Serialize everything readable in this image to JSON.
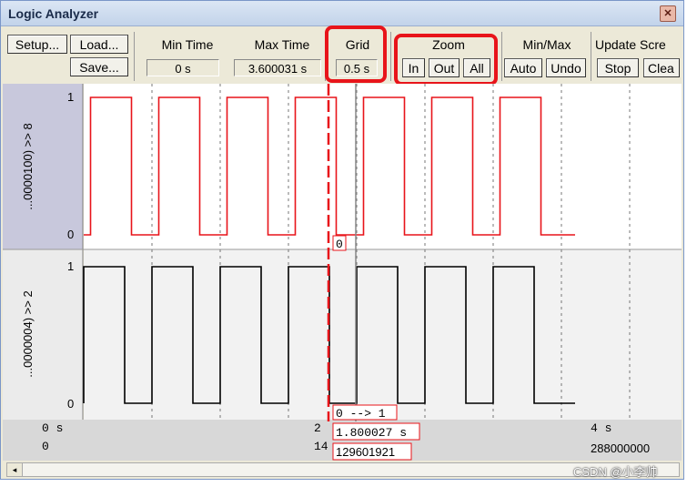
{
  "window": {
    "title": "Logic Analyzer",
    "close_glyph": "✕"
  },
  "toolbar": {
    "setup": "Setup...",
    "load": "Load...",
    "save": "Save...",
    "min_time": {
      "label": "Min Time",
      "value": "0 s"
    },
    "max_time": {
      "label": "Max Time",
      "value": "3.600031 s"
    },
    "grid": {
      "label": "Grid",
      "value": "0.5 s"
    },
    "zoom": {
      "label": "Zoom",
      "in": "In",
      "out": "Out",
      "all": "All"
    },
    "minmax": {
      "label": "Min/Max",
      "auto": "Auto",
      "undo": "Undo"
    },
    "update": {
      "label": "Update Scre",
      "stop": "Stop",
      "clear": "Clea"
    }
  },
  "signals": [
    {
      "name": "...0000100) >> 8",
      "high": "1",
      "low": "0",
      "color": "#e8141a",
      "selected": true
    },
    {
      "name": "...0000004) >> 2",
      "high": "1",
      "low": "0",
      "color": "#000000",
      "selected": false
    }
  ],
  "waveform": {
    "x_range_s": [
      0,
      3.600031
    ],
    "grid_s": 0.5,
    "cursor_s": 1.800027,
    "signal_1_edges_s": [
      0.05,
      0.35,
      0.55,
      0.85,
      1.05,
      1.35,
      1.55,
      1.85,
      2.05,
      2.35,
      2.55,
      2.85,
      3.05,
      3.35
    ],
    "signal_2_edges_s": [
      0.0,
      0.3,
      0.5,
      0.8,
      1.0,
      1.3,
      1.5,
      1.8,
      2.0,
      2.3,
      2.5,
      2.8,
      3.0,
      3.3
    ]
  },
  "annotations": {
    "sig1_value": "0",
    "sig2_transition": "0 --> 1"
  },
  "time_axis": {
    "t0": "0 s",
    "s0": "0",
    "t_mid": "2",
    "s_mid": "14",
    "cursor_time": "1.800027 s",
    "cursor_samples": "129601921",
    "t_end": "4 s",
    "s_end": "288000000"
  },
  "scrollbar": {
    "left_arrow": "◂"
  },
  "watermark": "CSDN @小李帅"
}
